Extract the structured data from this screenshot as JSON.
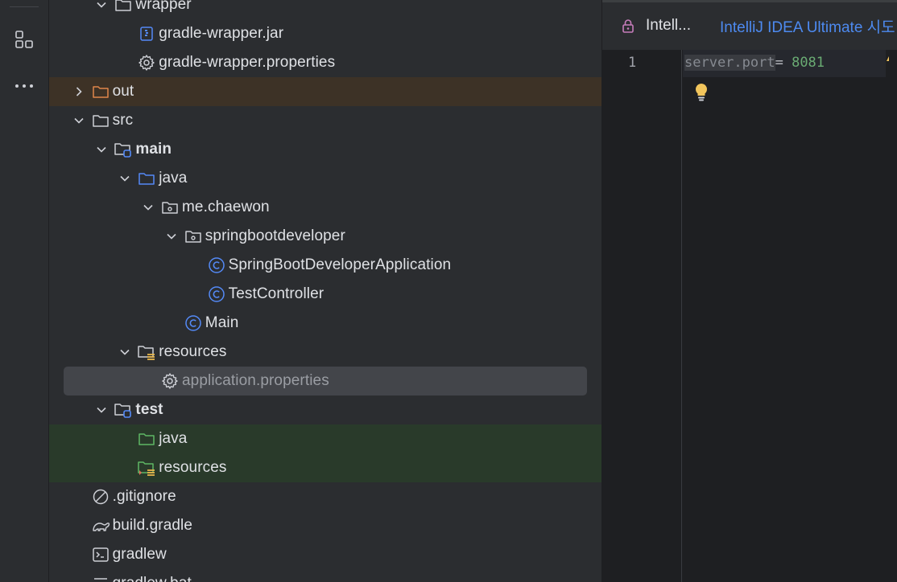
{
  "tree": {
    "items": [
      {
        "label": "wrapper",
        "depth": 3,
        "type": "folder",
        "expanded": true
      },
      {
        "label": "gradle-wrapper.jar",
        "depth": 4,
        "type": "jar"
      },
      {
        "label": "gradle-wrapper.properties",
        "depth": 4,
        "type": "properties"
      },
      {
        "label": "out",
        "depth": 2,
        "type": "folder-excluded",
        "expanded": false
      },
      {
        "label": "src",
        "depth": 2,
        "type": "folder",
        "expanded": true
      },
      {
        "label": "main",
        "depth": 3,
        "type": "module-folder",
        "expanded": true
      },
      {
        "label": "java",
        "depth": 4,
        "type": "source-folder",
        "expanded": true
      },
      {
        "label": "me.chaewon",
        "depth": 5,
        "type": "package",
        "expanded": true
      },
      {
        "label": "springbootdeveloper",
        "depth": 6,
        "type": "package",
        "expanded": true
      },
      {
        "label": "SpringBootDeveloperApplication",
        "depth": 7,
        "type": "class"
      },
      {
        "label": "TestController",
        "depth": 7,
        "type": "class"
      },
      {
        "label": "Main",
        "depth": 6,
        "type": "class"
      },
      {
        "label": "resources",
        "depth": 4,
        "type": "resources-folder",
        "expanded": true
      },
      {
        "label": "application.properties",
        "depth": 5,
        "type": "properties",
        "selected": true
      },
      {
        "label": "test",
        "depth": 3,
        "type": "module-folder",
        "expanded": true
      },
      {
        "label": "java",
        "depth": 4,
        "type": "test-source-folder"
      },
      {
        "label": "resources",
        "depth": 4,
        "type": "test-resources-folder"
      },
      {
        "label": ".gitignore",
        "depth": 2,
        "type": "ignore"
      },
      {
        "label": "build.gradle",
        "depth": 2,
        "type": "gradle"
      },
      {
        "label": "gradlew",
        "depth": 2,
        "type": "shell"
      },
      {
        "label": "gradlew.bat",
        "depth": 2,
        "type": "bat"
      }
    ]
  },
  "editor": {
    "tab_label": "Intell...",
    "banner_text": "IntelliJ IDEA Ultimate 시도",
    "line_number": "1",
    "code": {
      "key": "server.port",
      "eq": "= ",
      "value": "8081"
    }
  },
  "colors": {
    "accent_link": "#4d8af0",
    "class_icon": "#548af7",
    "excluded_folder": "#e0864a",
    "test_folder": "#5fb865",
    "bulb": "#f2c55c"
  }
}
